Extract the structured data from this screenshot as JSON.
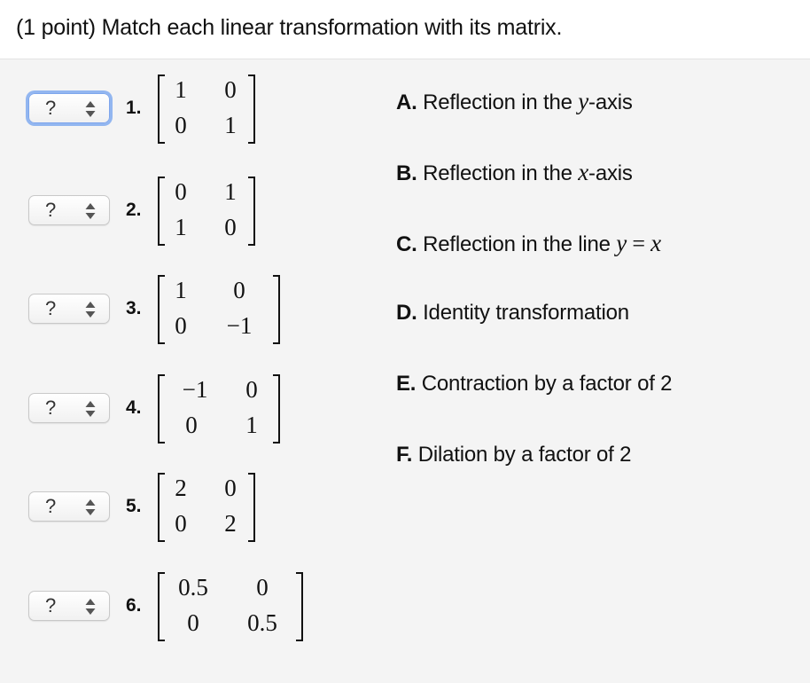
{
  "header": {
    "title": "(1 point) Match each linear transformation with its matrix."
  },
  "select_placeholder": "?",
  "items": [
    {
      "number": "1.",
      "matrix": [
        [
          "1",
          "0"
        ],
        [
          "0",
          "1"
        ]
      ]
    },
    {
      "number": "2.",
      "matrix": [
        [
          "0",
          "1"
        ],
        [
          "1",
          "0"
        ]
      ]
    },
    {
      "number": "3.",
      "matrix": [
        [
          "1",
          "0"
        ],
        [
          "0",
          "−1"
        ]
      ]
    },
    {
      "number": "4.",
      "matrix": [
        [
          "−1",
          "0"
        ],
        [
          "0",
          "1"
        ]
      ]
    },
    {
      "number": "5.",
      "matrix": [
        [
          "2",
          "0"
        ],
        [
          "0",
          "2"
        ]
      ]
    },
    {
      "number": "6.",
      "matrix": [
        [
          "0.5",
          "0"
        ],
        [
          "0",
          "0.5"
        ]
      ]
    }
  ],
  "answers": [
    {
      "letter": "A.",
      "text_before": "Reflection in the ",
      "var1": "y",
      "text_after": "-axis"
    },
    {
      "letter": "B.",
      "text_before": "Reflection in the ",
      "var1": "x",
      "text_after": "-axis"
    },
    {
      "letter": "C.",
      "text_before": "Reflection in the line ",
      "var1": "y",
      "op": " = ",
      "var2": "x"
    },
    {
      "letter": "D.",
      "text_before": "Identity transformation"
    },
    {
      "letter": "E.",
      "text_before": "Contraction by a factor of 2"
    },
    {
      "letter": "F.",
      "text_before": "Dilation by a factor of 2"
    }
  ]
}
